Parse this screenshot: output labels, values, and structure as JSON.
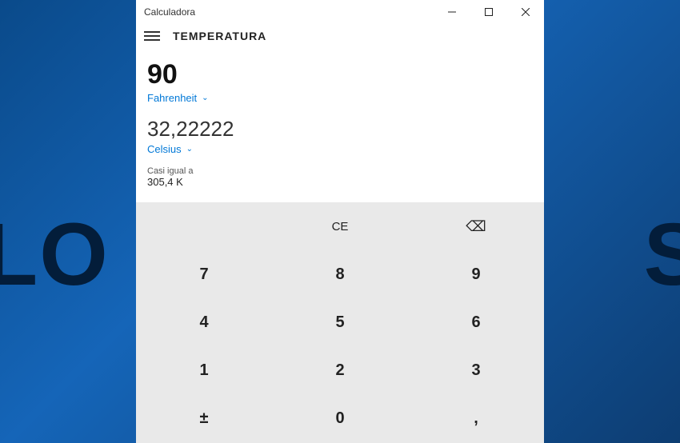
{
  "window": {
    "title": "Calculadora"
  },
  "header": {
    "mode": "TEMPERATURA"
  },
  "conversion": {
    "input_value": "90",
    "input_unit": "Fahrenheit",
    "output_value": "32,22222",
    "output_unit": "Celsius",
    "approx_label": "Casi igual a",
    "approx_value": "305,4 K"
  },
  "keypad": {
    "ce": "CE",
    "n7": "7",
    "n8": "8",
    "n9": "9",
    "n4": "4",
    "n5": "5",
    "n6": "6",
    "n1": "1",
    "n2": "2",
    "n3": "3",
    "sign": "±",
    "n0": "0",
    "dec": ","
  }
}
